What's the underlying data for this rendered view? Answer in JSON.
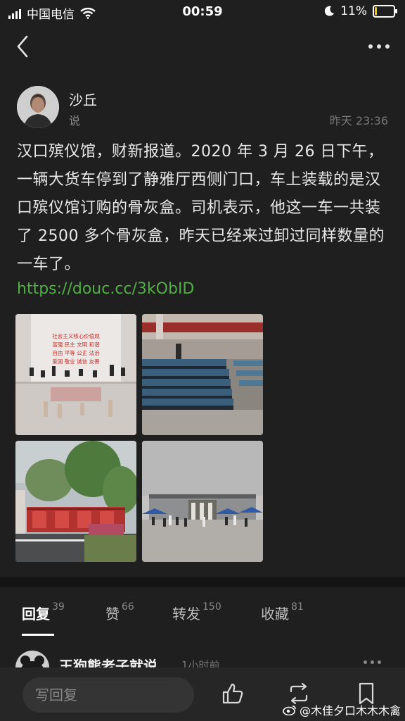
{
  "status_bar": {
    "carrier": "中国电信",
    "time": "00:59",
    "battery": "11%",
    "battery_level": 0.11
  },
  "post": {
    "author": "沙丘",
    "author_sub": "说",
    "time": "昨天 23:36",
    "text": "汉口殡仪馆，财新报道。2020 年 3 月 26 日下午，一辆大货车停到了静雅厅西侧门口，车上装载的是汉口殡仪馆订购的骨灰盒。司机表示，他这一车一共装了 2500 多个骨灰盒，昨天已经来过卸过同样数量的一车了。",
    "link": "https://douc.cc/3kObID",
    "photos": [
      {
        "name": "photo-hall-interior",
        "banner": [
          "社会主义核心价值观",
          "富强 民主 文明 和谐",
          "自由 平等 公正 法治",
          "爱国 敬业 诚信 友善"
        ]
      },
      {
        "name": "photo-boxes-stacked"
      },
      {
        "name": "photo-truck-outdoor"
      },
      {
        "name": "photo-building-exterior"
      }
    ]
  },
  "tabs": [
    {
      "label": "回复",
      "count": "39",
      "active": true
    },
    {
      "label": "赞",
      "count": "66",
      "active": false
    },
    {
      "label": "转发",
      "count": "150",
      "active": false
    },
    {
      "label": "收藏",
      "count": "81",
      "active": false
    }
  ],
  "comment": {
    "author": "王狗熊老子就说",
    "time": "1小时前"
  },
  "bottom_bar": {
    "reply_placeholder": "写回复",
    "watermark": "@木佳夕口木木木禽"
  },
  "colors": {
    "background": "#1f1f1f",
    "link": "#4fb043",
    "battery": "#f0c419"
  }
}
